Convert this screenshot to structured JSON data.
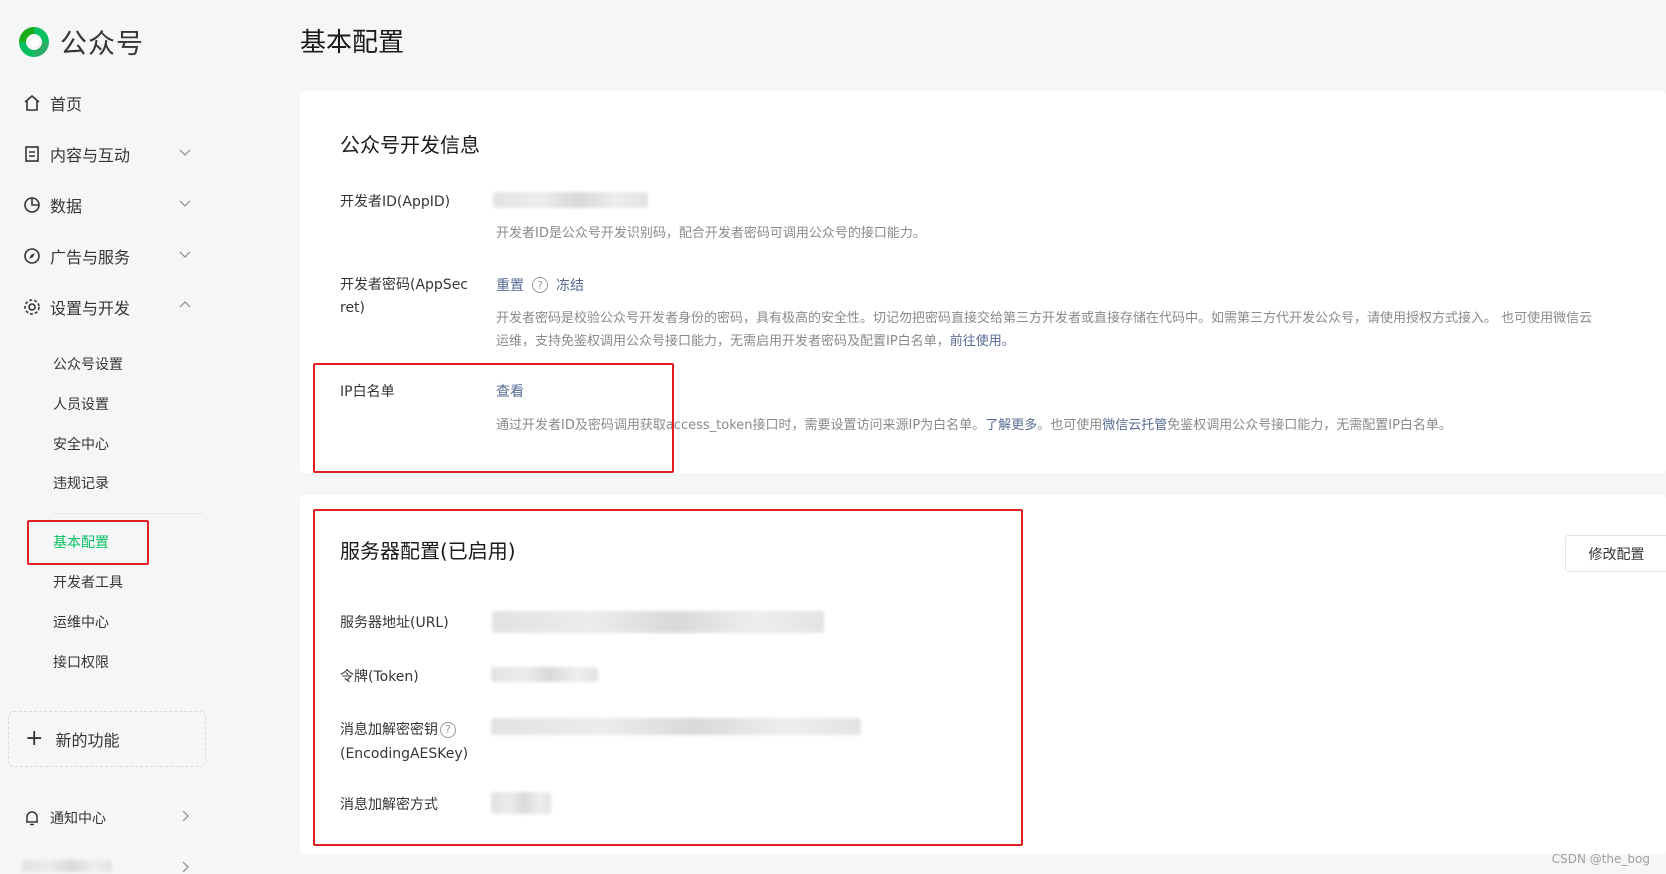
{
  "brand": {
    "name": "公众号",
    "color": "#07c160"
  },
  "sidebar": {
    "nav": [
      {
        "label": "首页",
        "icon": "home-icon"
      },
      {
        "label": "内容与互动",
        "icon": "document-icon"
      },
      {
        "label": "数据",
        "icon": "pie-chart-icon"
      },
      {
        "label": "广告与服务",
        "icon": "compass-icon"
      },
      {
        "label": "设置与开发",
        "icon": "gear-icon"
      }
    ],
    "settings_items": [
      "公众号设置",
      "人员设置",
      "安全中心",
      "违规记录"
    ],
    "dev_items": [
      "基本配置",
      "开发者工具",
      "运维中心",
      "接口权限"
    ],
    "active_item": "基本配置",
    "new_feature": "新的功能",
    "notify": "通知中心"
  },
  "page": {
    "title": "基本配置"
  },
  "dev_info": {
    "title": "公众号开发信息",
    "appid": {
      "label": "开发者ID(AppID)",
      "desc": "开发者ID是公众号开发识别码，配合开发者密码可调用公众号的接口能力。"
    },
    "secret": {
      "label_line1": "开发者密码(AppSec",
      "label_line2": "ret)",
      "reset": "重置",
      "freeze": "冻结",
      "desc_line1": "开发者密码是校验公众号开发者身份的密码，具有极高的安全性。切记勿把密码直接交给第三方开发者或直接存储在代码中。如需第三方代开发公众号，请使用授权方式接入。 也可使用微信云",
      "desc_line2": "运维，支持免鉴权调用公众号接口能力，无需启用开发者密码及配置IP白名单，",
      "desc_link": "前往使用。"
    },
    "ip_whitelist": {
      "label": "IP白名单",
      "view": "查看",
      "desc_a": "通过开发者ID及密码调用获取access_token接口时，需要设置访问来源IP为白名单。",
      "link_more": "了解更多",
      "desc_b": "。也可使用",
      "link_cloud": "微信云托管",
      "desc_c": "免鉴权调用公众号接口能力，无需配置IP白名单。"
    }
  },
  "server_config": {
    "title": "服务器配置(已启用)",
    "modify_button": "修改配置",
    "url_label": "服务器地址(URL)",
    "token_label": "令牌(Token)",
    "aes_label_line1": "消息加解密密钥",
    "aes_label_line2": "(EncodingAESKey)",
    "mode_label": "消息加解密方式"
  },
  "watermark": "CSDN @the_bog",
  "colors": {
    "highlight": "#e02020",
    "link": "#576b95",
    "active": "#07c160"
  }
}
